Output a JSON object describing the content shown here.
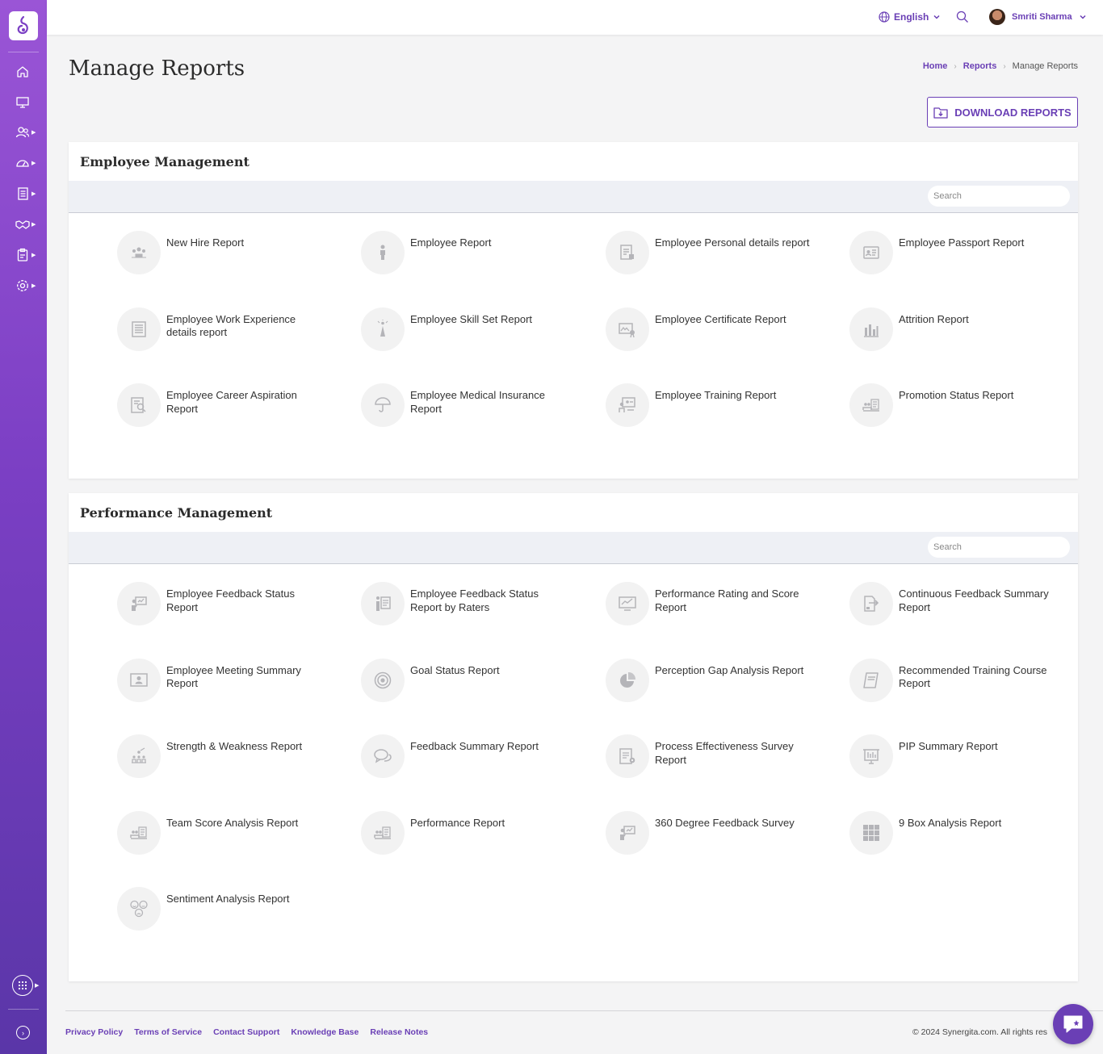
{
  "topbar": {
    "language": "English",
    "user_name": "Smriti Sharma"
  },
  "sidebar": {
    "items": [
      {
        "icon": "home-icon"
      },
      {
        "icon": "monitor-icon"
      },
      {
        "icon": "users-icon"
      },
      {
        "icon": "dashboard-gauge-icon"
      },
      {
        "icon": "document-list-icon"
      },
      {
        "icon": "handshake-icon"
      },
      {
        "icon": "clipboard-icon"
      },
      {
        "icon": "settings-gear-icon"
      }
    ]
  },
  "page": {
    "title": "Manage Reports",
    "breadcrumb": {
      "home": "Home",
      "reports": "Reports",
      "current": "Manage Reports"
    },
    "download_label": "DOWNLOAD REPORTS"
  },
  "employee_management": {
    "title": "Employee Management",
    "search_placeholder": "Search",
    "reports": [
      "New Hire Report",
      "Employee Report",
      "Employee Personal details report",
      "Employee Passport Report",
      "Employee Work Experience details report",
      "Employee Skill Set Report",
      "Employee Certificate Report",
      "Attrition Report",
      "Employee Career Aspiration Report",
      "Employee Medical Insurance Report",
      "Employee Training Report",
      "Promotion Status Report"
    ]
  },
  "performance_management": {
    "title": "Performance Management",
    "search_placeholder": "Search",
    "reports": [
      "Employee Feedback Status Report",
      "Employee Feedback Status Report by Raters",
      "Performance Rating and Score Report",
      "Continuous Feedback Summary Report",
      "Employee Meeting Summary Report",
      "Goal Status Report",
      "Perception Gap Analysis Report",
      "Recommended Training Course Report",
      "Strength & Weakness Report",
      "Feedback Summary Report",
      "Process Effectiveness Survey Report",
      "PIP Summary Report",
      "Team Score Analysis Report",
      "Performance Report",
      "360 Degree Feedback Survey",
      "9 Box Analysis Report",
      "Sentiment Analysis Report"
    ]
  },
  "footer": {
    "links": [
      "Privacy Policy",
      "Terms of Service",
      "Contact Support",
      "Knowledge Base",
      "Release Notes"
    ],
    "copyright": "© 2024 Synergita.com. All rights res"
  },
  "colors": {
    "accent": "#6a3fb5",
    "sidebar_top": "#9a55d6",
    "sidebar_bottom": "#5a36a8"
  }
}
